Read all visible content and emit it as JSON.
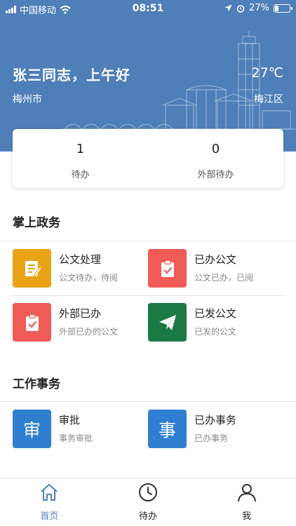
{
  "status_bar": {
    "carrier": "中国移动",
    "time": "08:51",
    "battery": "27%",
    "battery_level": 0.27
  },
  "header": {
    "greeting": "张三同志，上午好",
    "temperature": "27℃",
    "city": "梅州市",
    "district": "梅江区",
    "bg_color": "#4f7fb8"
  },
  "stats": [
    {
      "value": "1",
      "label": "待办"
    },
    {
      "value": "0",
      "label": "外部待办"
    }
  ],
  "sections": [
    {
      "title": "掌上政务",
      "items": [
        {
          "title": "公文处理",
          "subtitle": "公文待办，待阅",
          "icon": "document-edit-icon",
          "color": "#e8a317"
        },
        {
          "title": "已办公文",
          "subtitle": "公文已办，已阅",
          "icon": "clipboard-check-icon",
          "color": "#f05a57"
        },
        {
          "title": "外部已办",
          "subtitle": "外部已办的公文",
          "icon": "clipboard-check-icon",
          "color": "#f05a57"
        },
        {
          "title": "已发公文",
          "subtitle": "已发的公文",
          "icon": "paper-plane-icon",
          "color": "#1b7a44"
        }
      ]
    },
    {
      "title": "工作事务",
      "items": [
        {
          "title": "审批",
          "subtitle": "事务审批",
          "glyph": "审",
          "icon": "approval-icon",
          "color": "#2f7fd1"
        },
        {
          "title": "已办事务",
          "subtitle": "已办事务",
          "glyph": "事",
          "icon": "affairs-icon",
          "color": "#2f7fd1"
        }
      ]
    }
  ],
  "tabbar": {
    "items": [
      {
        "label": "首页",
        "icon": "home-icon",
        "active": true
      },
      {
        "label": "待办",
        "icon": "clock-icon",
        "active": false
      },
      {
        "label": "我",
        "icon": "user-icon",
        "active": false
      }
    ],
    "active_color": "#4f7fb8"
  }
}
